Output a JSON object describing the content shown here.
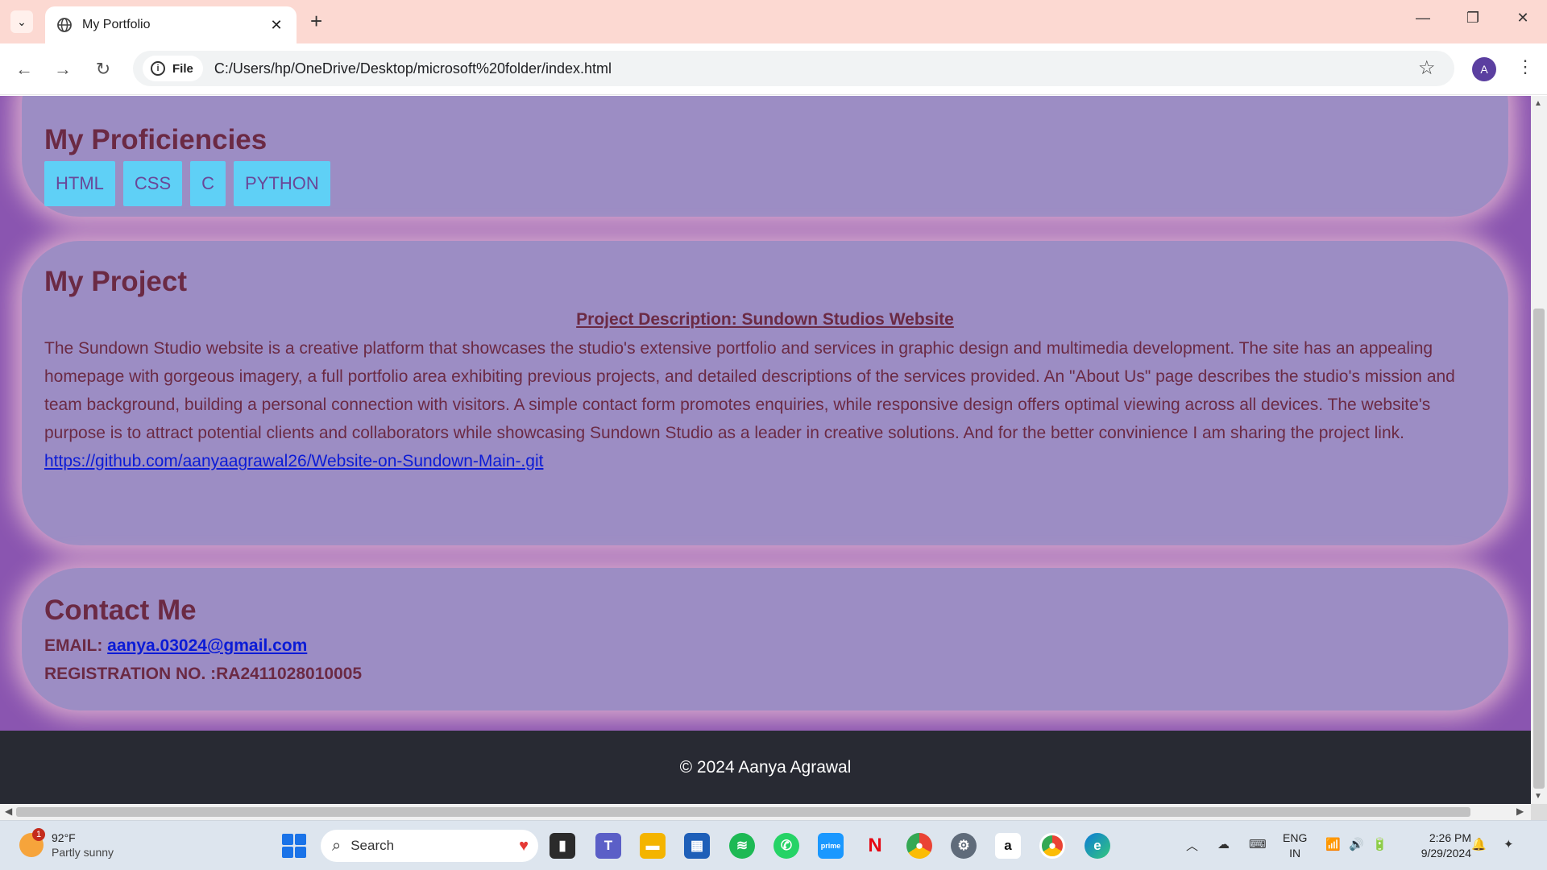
{
  "browser": {
    "tab_title": "My Portfolio",
    "new_tab_glyph": "+",
    "site_info_label": "File",
    "url": "C:/Users/hp/OneDrive/Desktop/microsoft%20folder/index.html",
    "profile_initial": "A"
  },
  "proficiencies": {
    "heading": "My Proficiencies",
    "skills": [
      "HTML",
      "CSS",
      "C",
      "PYTHON"
    ]
  },
  "project": {
    "heading": "My Project",
    "title": "Project Description: Sundown Studios Website",
    "description": "The Sundown Studio website is a creative platform that showcases the studio's extensive portfolio and services in graphic design and multimedia development. The site has an appealing homepage with gorgeous imagery, a full portfolio area exhibiting previous projects, and detailed descriptions of the services provided. An \"About Us\" page describes the studio's mission and team background, building a personal connection with visitors. A simple contact form promotes enquiries, while responsive design offers optimal viewing across all devices. The website's purpose is to attract potential clients and collaborators while showcasing Sundown Studio as a leader in creative solutions. And for the better convinience I am sharing the project link.",
    "link": "https://github.com/aanyaagrawal26/Website-on-Sundown-Main-.git"
  },
  "contact": {
    "heading": "Contact Me",
    "email_label": "EMAIL:",
    "email": "aanya.03024@gmail.com",
    "registration": "REGISTRATION NO. :RA2411028010005"
  },
  "footer": {
    "text": "© 2024 Aanya Agrawal"
  },
  "taskbar": {
    "weather_temp": "92°F",
    "weather_desc": "Partly sunny",
    "weather_badge": "1",
    "search_placeholder": "Search",
    "lang_line1": "ENG",
    "lang_line2": "IN",
    "time": "2:26 PM",
    "date": "9/29/2024",
    "apps": [
      "file-explorer",
      "teams",
      "folder",
      "store",
      "spotify",
      "whatsapp",
      "prime-video",
      "netflix",
      "chrome",
      "settings",
      "amazon",
      "chrome-profile",
      "edge"
    ]
  },
  "colors": {
    "page_bg": "#8a55b0",
    "card_bg": "#9c8dc4",
    "heading": "#6b2a44",
    "pill_bg": "#5fd0f6",
    "link": "#0b1bd6",
    "footer_bg": "#282a33",
    "tab_strip": "#fcd9d2"
  }
}
